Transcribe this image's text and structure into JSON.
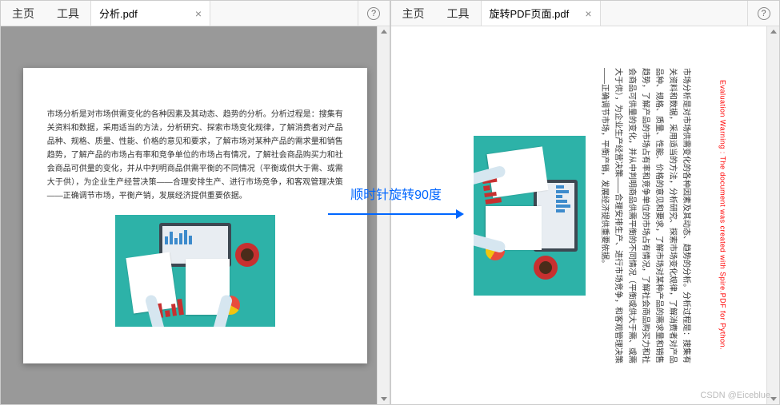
{
  "left_pane": {
    "menu_home": "主页",
    "menu_tools": "工具",
    "tab_title": "分析.pdf",
    "tab_close": "×",
    "help": "?"
  },
  "right_pane": {
    "menu_home": "主页",
    "menu_tools": "工具",
    "tab_title": "旋转PDF页面.pdf",
    "tab_close": "×",
    "help": "?"
  },
  "document": {
    "body_text": "市场分析是对市场供需变化的各种因素及其动态、趋势的分析。分析过程是：搜集有关资料和数据，采用适当的方法，分析研究、探索市场变化规律，了解消费者对产品品种、规格、质量、性能、价格的意见和要求，了解市场对某种产品的需求量和销售趋势，了解产品的市场占有率和竞争单位的市场占有情况，了解社会商品购买力和社会商品可供量的变化，并从中判明商品供需平衡的不同情况（平衡或供大于需、或需大于供），为企业生产经营决策——合理安排生产、进行市场竞争，和客观管理决策——正确调节市场，平衡产销，发展经济提供重要依据。"
  },
  "watermark": "Evaluation Warning : The document was created with Spire.PDF for Python.",
  "arrow_label": "顺时针旋转90度",
  "credit": "CSDN @Eiceblue"
}
